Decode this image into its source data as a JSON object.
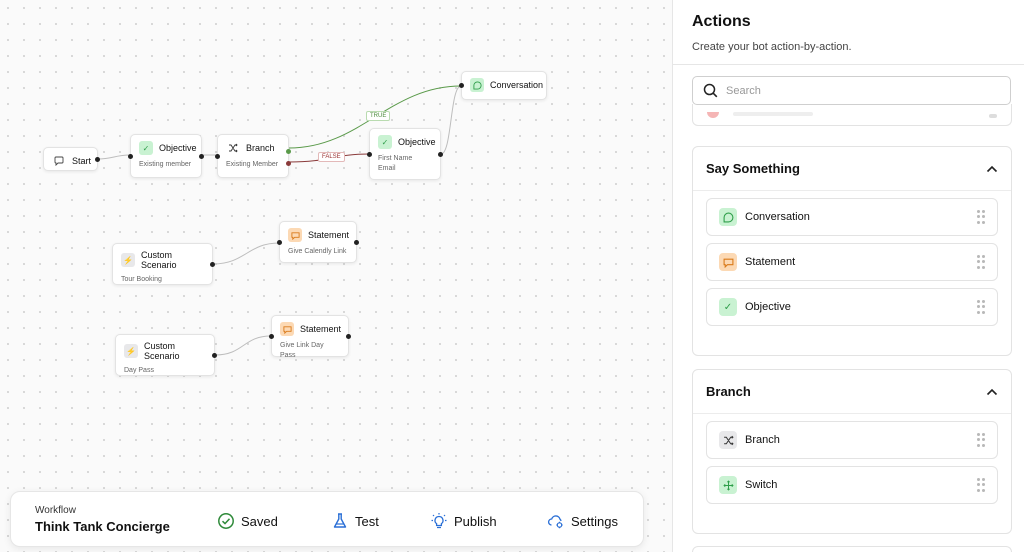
{
  "canvas": {
    "nodes": {
      "start": {
        "title": "Start",
        "icon": "chat-bubble-icon"
      },
      "objective1": {
        "title": "Objective",
        "sub1": "Existing member",
        "icon": "check-icon"
      },
      "branch": {
        "title": "Branch",
        "sub1": "Existing Member",
        "icon": "shuffle-icon"
      },
      "objective2": {
        "title": "Objective",
        "sub1": "First Name",
        "sub2": "Email",
        "icon": "check-icon"
      },
      "conversation": {
        "title": "Conversation",
        "icon": "conversation-icon"
      },
      "custom1": {
        "title": "Custom Scenario",
        "sub1": "Tour Booking",
        "icon": "bolt-icon"
      },
      "statement1": {
        "title": "Statement",
        "sub1": "Give Calendly Link",
        "icon": "speech-bubble-icon"
      },
      "custom2": {
        "title": "Custom Scenario",
        "sub1": "Day Pass",
        "icon": "bolt-icon"
      },
      "statement2": {
        "title": "Statement",
        "sub1": "Give Link Day Pass",
        "icon": "speech-bubble-icon"
      }
    },
    "edge_labels": {
      "true": "TRUE",
      "false": "FALSE"
    },
    "colors": {
      "true_edge": "#5a9a4a",
      "false_edge": "#8a3a3a",
      "edge": "#bdbdbd"
    }
  },
  "toolbar": {
    "workflow_label": "Workflow",
    "workflow_name": "Think Tank Concierge",
    "saved": "Saved",
    "test": "Test",
    "publish": "Publish",
    "settings": "Settings"
  },
  "panel": {
    "title": "Actions",
    "subtitle": "Create your bot action-by-action.",
    "search_placeholder": "Search",
    "groups": [
      {
        "title": "Say Something",
        "items": [
          {
            "label": "Conversation",
            "icon": "conversation-icon"
          },
          {
            "label": "Statement",
            "icon": "speech-bubble-icon"
          },
          {
            "label": "Objective",
            "icon": "check-icon"
          }
        ]
      },
      {
        "title": "Branch",
        "items": [
          {
            "label": "Branch",
            "icon": "shuffle-icon"
          },
          {
            "label": "Switch",
            "icon": "switch-icon"
          }
        ]
      }
    ]
  }
}
